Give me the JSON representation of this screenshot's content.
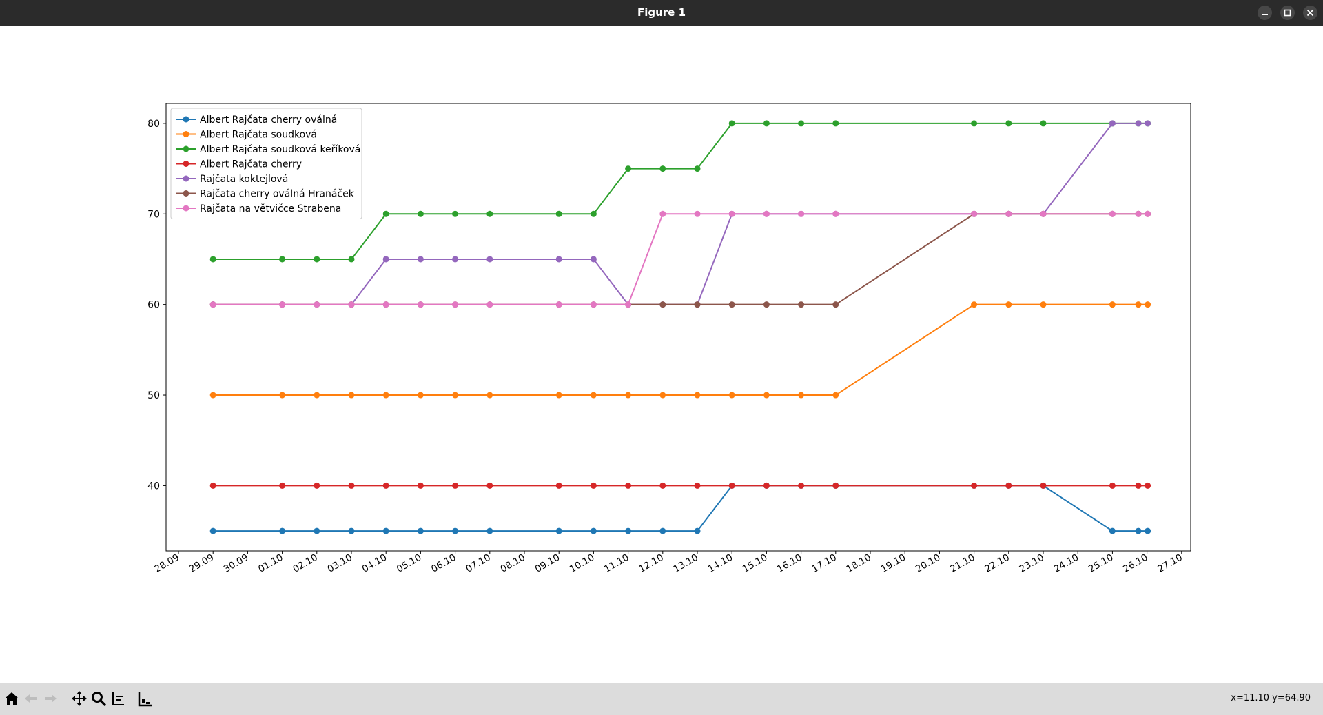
{
  "window": {
    "title": "Figure 1"
  },
  "status": {
    "coords": "x=11.10 y=64.90"
  },
  "toolbar": {
    "buttons": [
      "home-icon",
      "back-icon",
      "forward-icon",
      "pan-icon",
      "zoom-icon",
      "subplots-icon",
      "save-icon"
    ]
  },
  "chart_data": {
    "type": "line",
    "title": "",
    "xlabel": "",
    "ylabel": "",
    "ylim": [
      32.8,
      82.2
    ],
    "yticks": [
      40,
      50,
      60,
      70,
      80
    ],
    "xlim": [
      "28.09",
      "27.10"
    ],
    "xtick_labels": [
      "28.09",
      "29.09",
      "30.09",
      "01.10",
      "02.10",
      "03.10",
      "04.10",
      "05.10",
      "06.10",
      "07.10",
      "08.10",
      "09.10",
      "10.10",
      "11.10",
      "12.10",
      "13.10",
      "14.10",
      "15.10",
      "16.10",
      "17.10",
      "18.10",
      "19.10",
      "20.10",
      "21.10",
      "22.10",
      "23.10",
      "24.10",
      "25.10",
      "26.10",
      "27.10"
    ],
    "legend_position": "upper-left",
    "grid": false,
    "x": [
      "29.09",
      "01.10",
      "02.10",
      "03.10",
      "04.10",
      "05.10",
      "06.10",
      "07.10",
      "09.10",
      "10.10",
      "11.10",
      "12.10",
      "13.10",
      "14.10",
      "15.10",
      "16.10",
      "17.10",
      "21.10",
      "22.10",
      "23.10",
      "25.10",
      "26.10",
      "26.10"
    ],
    "series": [
      {
        "name": "Albert Rajčata cherry oválná",
        "color": "#1f77b4",
        "values": [
          35,
          35,
          35,
          35,
          35,
          35,
          35,
          35,
          35,
          35,
          35,
          35,
          35,
          40,
          40,
          40,
          40,
          40,
          40,
          40,
          35,
          35,
          35
        ]
      },
      {
        "name": "Albert Rajčata soudková",
        "color": "#ff7f0e",
        "values": [
          50,
          50,
          50,
          50,
          50,
          50,
          50,
          50,
          50,
          50,
          50,
          50,
          50,
          50,
          50,
          50,
          50,
          60,
          60,
          60,
          60,
          60,
          60
        ]
      },
      {
        "name": "Albert Rajčata soudková keříková",
        "color": "#2ca02c",
        "values": [
          65,
          65,
          65,
          65,
          70,
          70,
          70,
          70,
          70,
          70,
          75,
          75,
          75,
          80,
          80,
          80,
          80,
          80,
          80,
          80,
          80,
          80,
          80
        ]
      },
      {
        "name": "Albert Rajčata cherry",
        "color": "#d62728",
        "values": [
          40,
          40,
          40,
          40,
          40,
          40,
          40,
          40,
          40,
          40,
          40,
          40,
          40,
          40,
          40,
          40,
          40,
          40,
          40,
          40,
          40,
          40,
          40
        ]
      },
      {
        "name": "Rajčata koktejlová",
        "color": "#9467bd",
        "values": [
          60,
          60,
          60,
          60,
          65,
          65,
          65,
          65,
          65,
          65,
          60,
          60,
          60,
          70,
          70,
          70,
          70,
          70,
          70,
          70,
          80,
          80,
          80
        ]
      },
      {
        "name": "Rajčata cherry oválná Hranáček",
        "color": "#8c564b",
        "values": [
          60,
          60,
          60,
          60,
          60,
          60,
          60,
          60,
          60,
          60,
          60,
          60,
          60,
          60,
          60,
          60,
          60,
          70,
          70,
          70,
          70,
          70,
          70
        ]
      },
      {
        "name": "Rajčata na větvičce Strabena",
        "color": "#e377c2",
        "values": [
          60,
          60,
          60,
          60,
          60,
          60,
          60,
          60,
          60,
          60,
          60,
          70,
          70,
          70,
          70,
          70,
          70,
          70,
          70,
          70,
          70,
          70,
          70
        ]
      }
    ]
  }
}
